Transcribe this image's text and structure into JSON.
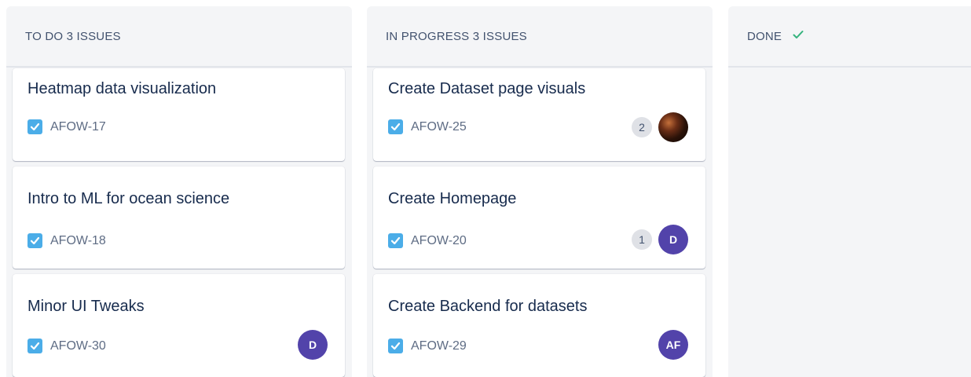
{
  "columns": [
    {
      "header": "TO DO 3 ISSUES",
      "cards": [
        {
          "title": "Heatmap data visualization",
          "key": "AFOW-17"
        },
        {
          "title": "Intro to ML for ocean science",
          "key": "AFOW-18"
        },
        {
          "title": "Minor UI Tweaks",
          "key": "AFOW-30",
          "avatar": "D"
        }
      ]
    },
    {
      "header": "IN PROGRESS 3 ISSUES",
      "cards": [
        {
          "title": "Create Dataset page visuals",
          "key": "AFOW-25",
          "count": "2",
          "avatar": "photo"
        },
        {
          "title": "Create Homepage",
          "key": "AFOW-20",
          "count": "1",
          "avatar": "D"
        },
        {
          "title": "Create Backend for datasets",
          "key": "AFOW-29",
          "avatar": "AF"
        }
      ]
    },
    {
      "header": "DONE",
      "header_icon": "check-icon",
      "cards": []
    }
  ],
  "colors": {
    "issue_type": "#4bade8",
    "avatar": "#5243aa",
    "done_check": "#36b37e",
    "column_bg": "#f4f5f7"
  }
}
